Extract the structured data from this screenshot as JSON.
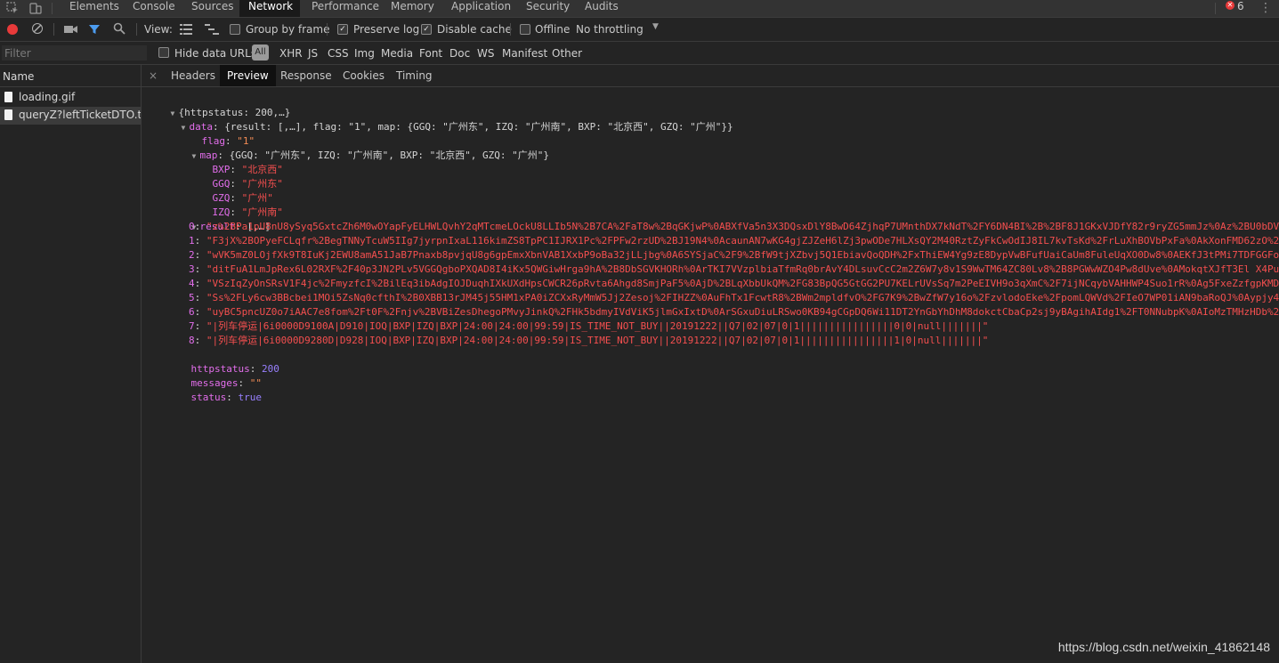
{
  "top_tabs": [
    "Elements",
    "Console",
    "Sources",
    "Network",
    "Performance",
    "Memory",
    "Application",
    "Security",
    "Audits"
  ],
  "error_count": "6",
  "toolbar": {
    "view_label": "View:",
    "group_by_frame": "Group by frame",
    "preserve_log": "Preserve log",
    "disable_cache": "Disable cache",
    "offline": "Offline",
    "throttling": "No throttling"
  },
  "filter": {
    "placeholder": "Filter",
    "hide_data_urls": "Hide data URLs",
    "all": "All",
    "types": [
      "XHR",
      "JS",
      "CSS",
      "Img",
      "Media",
      "Font",
      "Doc",
      "WS",
      "Manifest",
      "Other"
    ]
  },
  "requests": {
    "header": "Name",
    "items": [
      "loading.gif",
      "queryZ?leftTicketDTO.tr..."
    ]
  },
  "detail_tabs": [
    "Headers",
    "Preview",
    "Response",
    "Cookies",
    "Timing"
  ],
  "preview": {
    "root": "{httpstatus: 200,…}",
    "data_key": "data",
    "data_summary": "{result: [,…], flag: \"1\", map: {GGQ: \"广州东\", IZQ: \"广州南\", BXP: \"北京西\", GZQ: \"广州\"}}",
    "flag_key": "flag",
    "flag_val": "\"1\"",
    "map_key": "map",
    "map_summary": "{GGQ: \"广州东\", IZQ: \"广州南\", BXP: \"北京西\", GZQ: \"广州\"}",
    "map_entries": [
      {
        "k": "BXP",
        "v": "北京西"
      },
      {
        "k": "GGQ",
        "v": "广州东"
      },
      {
        "k": "GZQ",
        "v": "广州"
      },
      {
        "k": "IZQ",
        "v": "广州南"
      }
    ],
    "result_key": "result",
    "result_summary": "[,…]",
    "result": [
      {
        "i": "0",
        "v": "z%2BPa1pU8nU8ySyq5GxtcZh6M0wOYapFyELHWLQvhY2qMTcmeLOckU8LLIb5N%2B7CA%2FaT8w%2BqGKjwP%0ABXfVa5n3X3DQsxDlY8BwD64ZjhqP7UMnthDX7kNdT%2FY6DN4BI%2B%2BF8J1GKxVJDfY82r9ryZG5mmJz%0Az%2BU0bDVU"
      },
      {
        "i": "1",
        "v": "F3jX%2BOPyeFCLqfr%2BegTNNyTcuW5IIg7jyrpnIxaL116kimZS8TpPC1IJRX1Pc%2FPFw2rzUD%2BJ19N4%0AcaunAN7wKG4gjZJZeH6lZj3pwODe7HLXsQY2M40RztZyFkCwOdIJ8IL7kvTsKd%2FrLuXhBOVbPxFa%0AkXonFMD62zO%2B"
      },
      {
        "i": "2",
        "v": "wVK5mZ0LOjfXk9T8IuKj2EWU8amA51JaB7Pnaxb8pvjqU8g6gpEmxXbnVAB1XxbP9oBa32jLLjbg%0A6SYSjaC%2F9%2BfW9tjXZbvj5Q1EbiavQoQDH%2FxThiEW4Yg9zE8DypVwBFufUaiCaUm8FuleUqXO0Dw8%0AEKfJ3tPMi7TDFGGFov"
      },
      {
        "i": "3",
        "v": "ditFuA1LmJpRex6L02RXF%2F40p3JN2PLv5VGGQgboPXQAD8I4iKx5QWGiwHrga9hA%2B8DbSGVKHORh%0ArTKI7VVzplbiaTfmRq0brAvY4DLsuvCcC2m2Z6W7y8v1S9WwTM64ZC80Lv8%2B8PGWwWZO4Pw8dUve%0AMokqtXJfT3El X4Pu5N"
      },
      {
        "i": "4",
        "v": "VSzIqZyOnSRsV1F4jc%2FmyzfcI%2BilEq3ibAdgIOJDuqhIXkUXdHpsCWCR26pRvta6Ahgd8SmjPaF5%0AjD%2BLqXbbUkQM%2FG83BpQG5GtGG2PU7KELrUVsSq7m2PeEIVH9o3qXmC%2F7ijNCqybVAHHWP4Suo1rR%0Ag5FxeZzfgpKMDO"
      },
      {
        "i": "5",
        "v": "Ss%2FLy6cw3BBcbei1MOi5ZsNq0cfthI%2B0XBB13rJM45j55HM1xPA0iZCXxRyMmW5Jj2Zesoj%2FIHZZ%0AuFhTx1FcwtR8%2BWm2mpldfvO%2FG7K9%2BwZfW7y16o%2FzvlodoEke%2FpomLQWVd%2FIeO7WP01iAN9baRoQJ%0Aypjy4O"
      },
      {
        "i": "6",
        "v": "uyBC5pncUZ0o7iAAC7e8fom%2Ft0F%2Fnjv%2BVBiZesDhegoPMvyJinkQ%2FHk5bdmyIVdViK5jlmGxIxtD%0ArSGxuDiuLRSwo0KB94gCGpDQ6Wi11DT2YnGbYhDhM8dokctCbaCp2sj9yBAgihAIdg1%2FT0NNubpK%0AIoMzTMHzHDb%2B"
      },
      {
        "i": "7",
        "v": "|列车停运|6i0000D9100A|D910|IOQ|BXP|IZQ|BXP|24:00|24:00|99:59|IS_TIME_NOT_BUY||20191222||Q7|02|07|0|1||||||||||||||||0|0|null|||||||"
      },
      {
        "i": "8",
        "v": "|列车停运|6i0000D9280D|D928|IOQ|BXP|IZQ|BXP|24:00|24:00|99:59|IS_TIME_NOT_BUY||20191222||Q7|02|07|0|1||||||||||||||||1|0|null|||||||"
      }
    ],
    "httpstatus_key": "httpstatus",
    "httpstatus_val": "200",
    "messages_key": "messages",
    "messages_val": "\"\"",
    "status_key": "status",
    "status_val": "true"
  },
  "watermark": "https://blog.csdn.net/weixin_41862148",
  "colors": {
    "active_tab_bg": "#1a1a1a",
    "record_red": "#e83a3a",
    "filter_blue": "#4c9cf0",
    "string_red": "#f54f4f",
    "key_magenta": "#e36eec",
    "number_purple": "#9980ff"
  }
}
